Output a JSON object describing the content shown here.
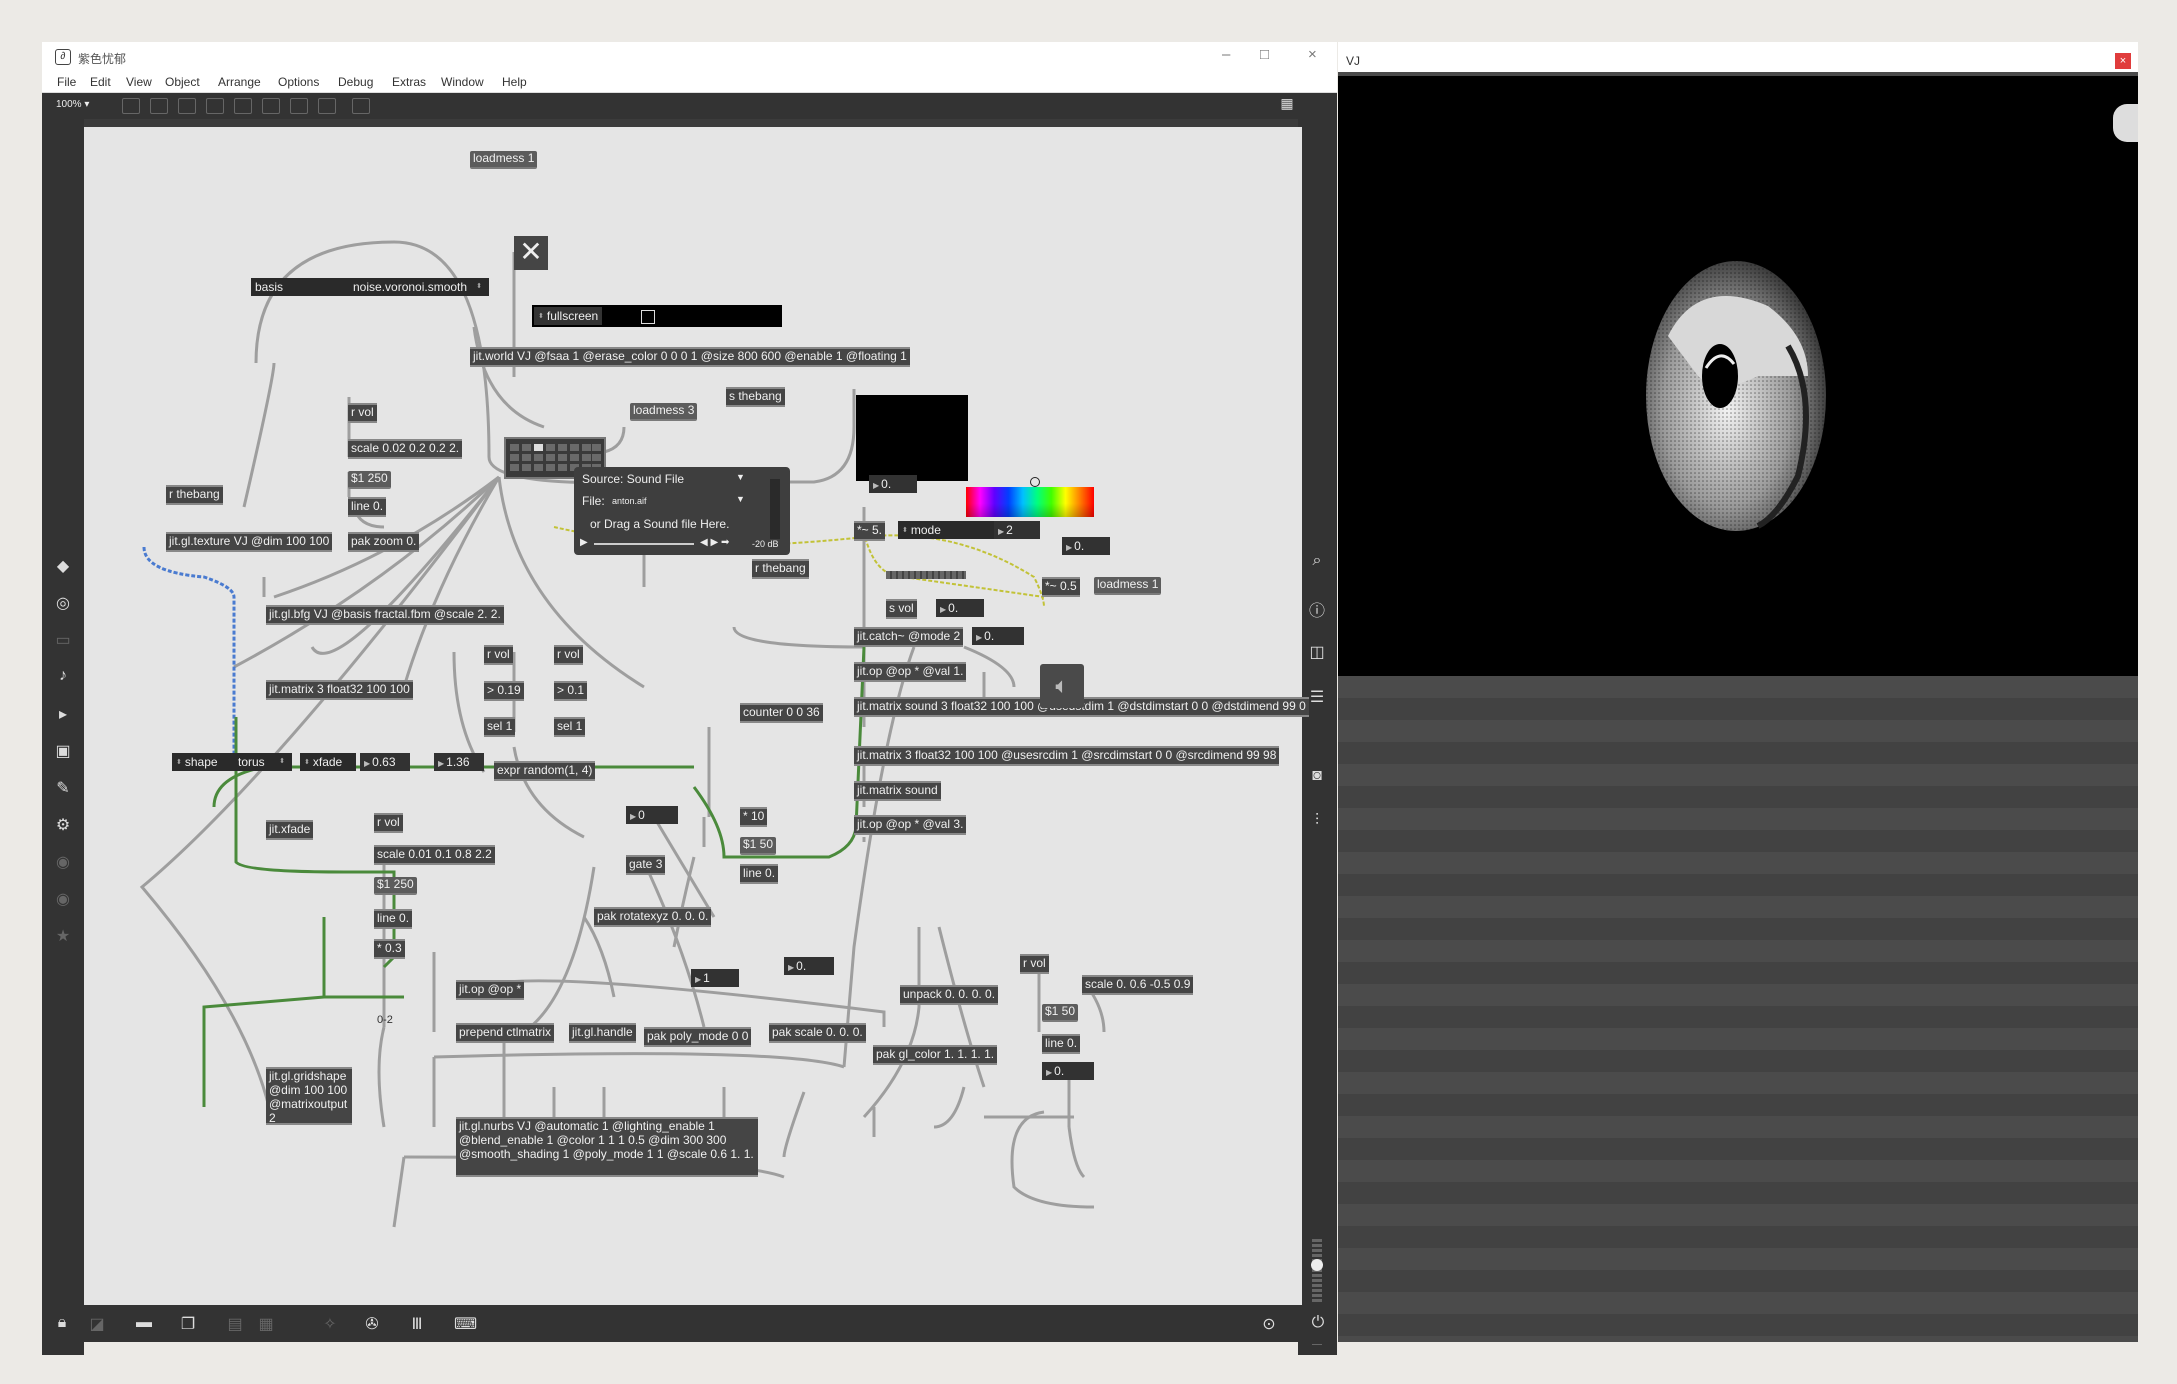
{
  "max_window": {
    "title": "紫色忧郁",
    "menu": [
      "File",
      "Edit",
      "View",
      "Object",
      "Arrange",
      "Options",
      "Debug",
      "Extras",
      "Window",
      "Help"
    ],
    "zoom": "100%"
  },
  "vj_window": {
    "title": "VJ",
    "close": "×"
  },
  "patch": {
    "loadmess1": "loadmess 1",
    "fullscreen": "fullscreen",
    "jitworld": "jit.world VJ @fsaa 1 @erase_color 0 0 0 1 @size 800 600 @enable 1 @floating 1",
    "s_thebang": "s thebang",
    "loadmess3": "loadmess 3",
    "basis_label": "basis",
    "basis_value": "noise.voronoi.smooth",
    "r_vol_1": "r vol",
    "scale_1": "scale 0.02 0.2 0.2 2.",
    "msg_250_1": "$1 250",
    "line_1": "line 0.",
    "pak_zoom": "pak zoom 0.",
    "r_thebang_1": "r thebang",
    "jit_texture": "jit.gl.texture VJ @dim 100 100",
    "jit_bfg": "jit.gl.bfg VJ @basis fractal.fbm @scale 2. 2.",
    "jit_matrix_3": "jit.matrix 3 float32 100 100",
    "r_vol_2": "r vol",
    "gt_019": "> 0.19",
    "sel_1a": "sel 1",
    "r_vol_3": "r vol",
    "gt_01": "> 0.1",
    "sel_1b": "sel 1",
    "expr_random": "expr random(1, 4)",
    "shape_label": "shape",
    "shape_value": "torus",
    "xfade_label": "xfade",
    "xfade_value": "0.63",
    "num_136": "1.36",
    "jit_xfade": "jit.xfade",
    "r_vol_4": "r vol",
    "scale_2": "scale 0.01 0.1 0.8 2.2",
    "msg_250_2": "$1 250",
    "line_2": "line 0.",
    "mul_03": "* 0.3",
    "num_0": "0",
    "gate_3": "gate 3",
    "pak_rotate": "pak rotatexyz 0. 0. 0.",
    "counter": "counter 0 0 36",
    "mul_10": "* 10",
    "msg_50_1": "$1 50",
    "line_3": "line 0.",
    "jit_op_op": "jit.op @op *",
    "label_02": "0-2",
    "prepend_ctlmatrix": "prepend ctlmatrix",
    "jit_handle": "jit.gl.handle",
    "num_1": "1",
    "pak_polymode": "pak poly_mode 0 0",
    "num_0_dot": "0.",
    "pak_scale": "pak scale 0. 0. 0.",
    "jit_gridshape": "jit.gl.gridshape @dim 100 100 @matrixoutput 2",
    "jit_nurbs": "jit.gl.nurbs VJ @automatic 1 @lighting_enable 1 @blend_enable 1 @color 1 1 1 0.5 @dim 300 300 @smooth_shading 1 @poly_mode 1 1 @scale 0.6 1. 1.",
    "playlist_source": "Source: Sound File",
    "playlist_file_label": "File:",
    "playlist_file": "anton.aif",
    "playlist_drop": "or Drag a Sound file Here.",
    "playlist_db": "-20 dB",
    "num_a": "0.",
    "mul_5": "*~ 5.",
    "mode_label": "mode",
    "mode_value": "2",
    "r_thebang_2": "r thebang",
    "s_vol": "s vol",
    "num_b": "0.",
    "jit_catch": "jit.catch~ @mode 2",
    "num_c": "0.",
    "jit_op_val1": "jit.op @op * @val 1.",
    "jit_matrix_sound": "jit.matrix sound 3 float32 100 100 @usedstdim 1 @dstdimstart 0 0 @dstdimend 99 0",
    "jit_matrix_src": "jit.matrix 3 float32 100 100 @usesrcdim 1 @srcdimstart 0 0 @srcdimend 99 98",
    "jit_matrix_sound2": "jit.matrix sound",
    "jit_op_val3": "jit.op @op * @val 3.",
    "num_d": "0.",
    "mul_05": "*~ 0.5",
    "loadmess1b": "loadmess 1",
    "r_vol_5": "r vol",
    "scale_3": "scale 0. 0.6 -0.5 0.9",
    "msg_50_2": "$1 50",
    "line_4": "line 0.",
    "num_e": "0.",
    "unpack": "unpack 0. 0. 0. 0.",
    "pak_color": "pak gl_color 1. 1. 1. 1."
  },
  "left_icons": [
    "cube-icon",
    "circle-icon",
    "rect-icon",
    "music-note-icon",
    "play-step-icon",
    "image-icon",
    "clip-icon",
    "plug-icon",
    "power-icon",
    "help-icon",
    "star-icon"
  ],
  "right_icons": [
    "search-icon",
    "info-icon",
    "columns-icon",
    "list-icon",
    "camera-icon",
    "sliders-icon"
  ]
}
